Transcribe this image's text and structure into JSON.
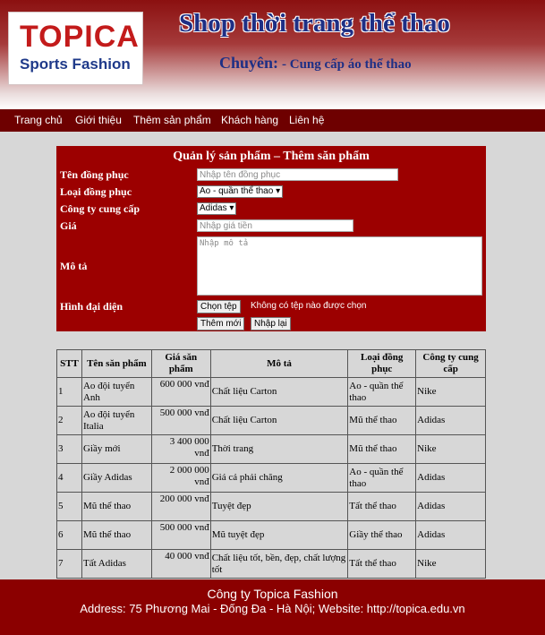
{
  "header": {
    "logo_top": "TOPICA",
    "logo_bottom": "Sports Fashion",
    "shop_title": "Shop thời trang thể thao",
    "specialty_label": "Chuyên:",
    "specialty_value": "- Cung cấp áo thể thao"
  },
  "nav": [
    "Trang chủ",
    "Giới thiệu",
    "Thêm sản phẩm",
    "Khách hàng",
    "Liên hệ"
  ],
  "form": {
    "title": "Quản lý sản phẩm – Thêm săn phẩm",
    "name_label": "Tên đồng phục",
    "name_placeholder": "Nhập tên đồng phục",
    "type_label": "Loại đồng phục",
    "type_value": "Ao - quần thể thao ▾",
    "supplier_label": "Công ty cung cấp",
    "supplier_value": "Adidas ▾",
    "price_label": "Giá",
    "price_placeholder": "Nhập giá tiền",
    "desc_label": "Mô tả",
    "desc_placeholder": "Nhập mô tả",
    "image_label": "Hình đại diện",
    "file_button": "Chọn tệp",
    "file_status": "Không có tệp nào được chọn",
    "add_button": "Thêm mới",
    "reset_button": "Nhập lại"
  },
  "table": {
    "headers": [
      "STT",
      "Tên săn phẩm",
      "Giá săn phẩm",
      "Mô tả",
      "Loại đồng phục",
      "Công ty cung cấp"
    ],
    "rows": [
      [
        "1",
        "Ao đội tuyển Anh",
        "600 000 vnđ",
        "Chất liệu Carton",
        "Ao - quần thể thao",
        "Nike"
      ],
      [
        "2",
        "Ao đội tuyển Italia",
        "500 000 vnđ",
        "Chất liệu Carton",
        "Mũ thể thao",
        "Adidas"
      ],
      [
        "3",
        "Giầy mới",
        "3 400 000 vnđ",
        "Thời trang",
        "Mũ thể thao",
        "Nike"
      ],
      [
        "4",
        "Giầy Adidas",
        "2 000 000 vnđ",
        "Giá cả phải chăng",
        "Ao - quần thể thao",
        "Adidas"
      ],
      [
        "5",
        "Mũ thể thao",
        "200 000 vnđ",
        "Tuyệt đẹp",
        "Tất thể thao",
        "Adidas"
      ],
      [
        "6",
        "Mũ thể thao",
        "500 000 vnđ",
        "Mũ tuyệt đẹp",
        "Giầy thể thao",
        "Adidas"
      ],
      [
        "7",
        "Tất Adidas",
        "40 000 vnđ",
        "Chất liệu tốt, bền, đẹp, chất lượng tốt",
        "Tất thể thao",
        "Nike"
      ]
    ]
  },
  "footer": {
    "company": "Công ty Topica Fashion",
    "address": "Address: 75 Phương Mai - Đống Đa - Hà Nội; Website: http://topica.edu.vn"
  }
}
